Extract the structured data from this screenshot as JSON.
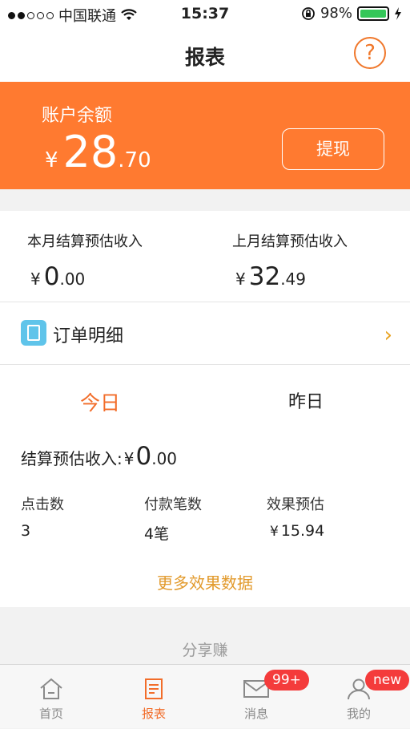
{
  "status_bar": {
    "carrier": "中国联通",
    "time": "15:37",
    "battery_percent": "98%",
    "signal_dots_full": 2,
    "signal_dots_total": 5,
    "battery_level": 0.98
  },
  "header": {
    "title": "报表",
    "help_icon": "question-circle-icon"
  },
  "balance": {
    "label": "账户余额",
    "currency": "¥",
    "amount_int": "28",
    "amount_dec": ".70",
    "withdraw_label": "提现"
  },
  "earnings": {
    "this_month": {
      "label": "本月结算预估收入",
      "currency": "¥",
      "int": "0",
      "dec": ".00"
    },
    "last_month": {
      "label": "上月结算预估收入",
      "currency": "¥",
      "int": "32",
      "dec": ".49"
    }
  },
  "order_detail": {
    "label": "订单明细",
    "icon": "document-icon",
    "chevron": "›"
  },
  "stats": {
    "tabs": [
      {
        "label": "今日",
        "active": true
      },
      {
        "label": "昨日",
        "active": false
      }
    ],
    "settle": {
      "label": "结算预估收入:",
      "currency": "¥",
      "int": "0",
      "dec": ".00"
    },
    "metrics": [
      {
        "label": "点击数",
        "value": "3"
      },
      {
        "label": "付款笔数",
        "value": "4笔"
      },
      {
        "label": "效果预估",
        "currency": "¥",
        "value": "15.94"
      }
    ],
    "more_link": "更多效果数据"
  },
  "share_label": "分享赚",
  "tabbar": {
    "items": [
      {
        "label": "首页",
        "icon": "home-icon"
      },
      {
        "label": "报表",
        "icon": "report-icon",
        "active": true
      },
      {
        "label": "消息",
        "icon": "mail-icon",
        "badge": "99+"
      },
      {
        "label": "我的",
        "icon": "user-icon",
        "badge": "new"
      }
    ]
  },
  "colors": {
    "accent": "#ff7a30",
    "link": "#e29a2c",
    "badge": "#f43b3b",
    "order_icon": "#5fc4ea"
  }
}
